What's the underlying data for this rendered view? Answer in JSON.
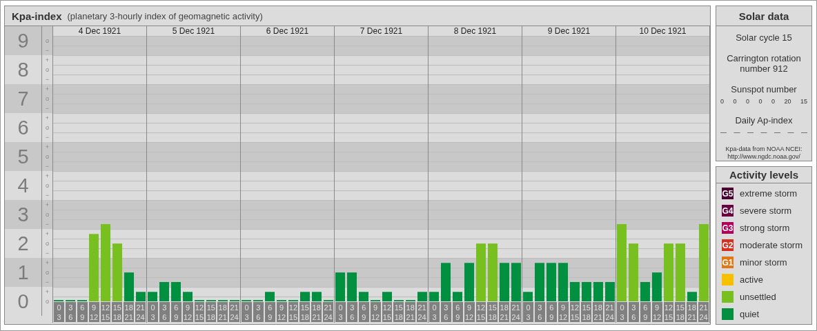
{
  "panel": {
    "title": "Kpa-index",
    "subtitle": "(planetary 3-hourly index of geomagnetic activity)"
  },
  "scale": [
    {
      "label": "9",
      "steps": [
        "o",
        "−"
      ]
    },
    {
      "label": "8",
      "steps": [
        "+",
        "o",
        "−"
      ]
    },
    {
      "label": "7",
      "steps": [
        "+",
        "o",
        "−"
      ]
    },
    {
      "label": "6",
      "steps": [
        "+",
        "o",
        "−"
      ]
    },
    {
      "label": "5",
      "steps": [
        "+",
        "o",
        "−"
      ]
    },
    {
      "label": "4",
      "steps": [
        "+",
        "o",
        "−"
      ]
    },
    {
      "label": "3",
      "steps": [
        "+",
        "o",
        "−"
      ]
    },
    {
      "label": "2",
      "steps": [
        "+",
        "o",
        "−"
      ]
    },
    {
      "label": "1",
      "steps": [
        "+",
        "o",
        "−"
      ]
    },
    {
      "label": "0",
      "steps": [
        "+",
        "o"
      ]
    }
  ],
  "days": [
    "4 Dec 1921",
    "5 Dec 1921",
    "6 Dec 1921",
    "7 Dec 1921",
    "8 Dec 1921",
    "9 Dec 1921",
    "10 Dec 1921"
  ],
  "chart_data": {
    "type": "bar",
    "stacked": true,
    "ylim": [
      0,
      9.17
    ],
    "yticks": [
      9,
      8,
      7,
      6,
      5,
      4,
      3,
      2,
      1,
      0
    ],
    "grid": true,
    "bands": [
      {
        "axis": "y",
        "from": 0.5,
        "to": 1.5
      },
      {
        "axis": "y",
        "from": 2.5,
        "to": 3.5
      },
      {
        "axis": "y",
        "from": 4.5,
        "to": 5.5
      },
      {
        "axis": "y",
        "from": 6.5,
        "to": 7.5
      },
      {
        "axis": "y",
        "from": 8.5,
        "to": 9.17
      }
    ],
    "categories": [
      "0 3",
      "3 6",
      "6 9",
      "9 12",
      "12 15",
      "15 18",
      "18 21",
      "21 24",
      "0 3",
      "3 6",
      "6 9",
      "9 12",
      "12 15",
      "15 18",
      "18 21",
      "21 24",
      "0 3",
      "3 6",
      "6 9",
      "9 12",
      "12 15",
      "15 18",
      "18 21",
      "21 24",
      "0 3",
      "3 6",
      "6 9",
      "9 12",
      "12 15",
      "15 18",
      "18 21",
      "21 24",
      "0 3",
      "3 6",
      "6 9",
      "9 12",
      "12 15",
      "15 18",
      "18 21",
      "21 24",
      "0 3",
      "3 6",
      "6 9",
      "9 12",
      "12 15",
      "15 18",
      "18 21",
      "21 24",
      "0 3",
      "3 6",
      "6 9",
      "9 12",
      "12 15",
      "15 18",
      "18 21",
      "21 24"
    ],
    "series": [
      {
        "color": "#009040",
        "values": [
          0,
          0,
          0,
          null,
          null,
          null,
          1,
          0.33,
          0.33,
          0.67,
          0.67,
          0.33,
          0,
          0,
          0,
          0,
          0,
          0,
          0.33,
          0,
          0,
          0.33,
          0.33,
          0,
          1,
          1,
          0.33,
          0,
          0.33,
          0,
          0,
          0.33,
          0.33,
          1.33,
          0.33,
          1.33,
          null,
          null,
          1.33,
          1.33,
          0.33,
          1.33,
          1.33,
          1.33,
          0.67,
          0.67,
          0.67,
          0.67,
          null,
          null,
          0.67,
          1,
          null,
          null,
          0.33,
          null
        ]
      },
      {
        "color": "#78c020",
        "values": [
          null,
          null,
          null,
          2.33,
          2.67,
          2,
          null,
          null,
          null,
          null,
          null,
          null,
          null,
          null,
          null,
          null,
          null,
          null,
          null,
          null,
          null,
          null,
          null,
          null,
          null,
          null,
          null,
          null,
          null,
          null,
          null,
          null,
          null,
          null,
          null,
          null,
          2,
          2,
          null,
          null,
          null,
          null,
          null,
          null,
          null,
          null,
          null,
          null,
          2.67,
          2,
          null,
          null,
          2,
          2,
          null,
          2.67
        ]
      }
    ]
  },
  "solar": {
    "title": "Solar data",
    "cycle": "Solar cycle 15",
    "rotation": "Carrington rotation number 912",
    "sunspot_label": "Sunspot number",
    "sunspots": [
      "0",
      "0",
      "0",
      "0",
      "0",
      "20",
      "15"
    ],
    "ap_label": "Daily Ap-index",
    "ap_values": [
      "—",
      "—",
      "—",
      "—",
      "—",
      "—",
      "—"
    ],
    "source": "Kpa-data from NOAA NCEI: http://www.ngdc.noaa.gov/"
  },
  "legend": {
    "title": "Activity levels",
    "items": [
      {
        "badge": "G5",
        "label": "extreme storm",
        "color": "#4a0030"
      },
      {
        "badge": "G4",
        "label": "severe storm",
        "color": "#6a0040"
      },
      {
        "badge": "G3",
        "label": "strong storm",
        "color": "#b0005a"
      },
      {
        "badge": "G2",
        "label": "moderate storm",
        "color": "#d83020"
      },
      {
        "badge": "G1",
        "label": "minor storm",
        "color": "#e07818"
      },
      {
        "label": "active",
        "color": "#f8c000"
      },
      {
        "label": "unsettled",
        "color": "#78c020"
      },
      {
        "label": "quiet",
        "color": "#009040"
      }
    ]
  }
}
